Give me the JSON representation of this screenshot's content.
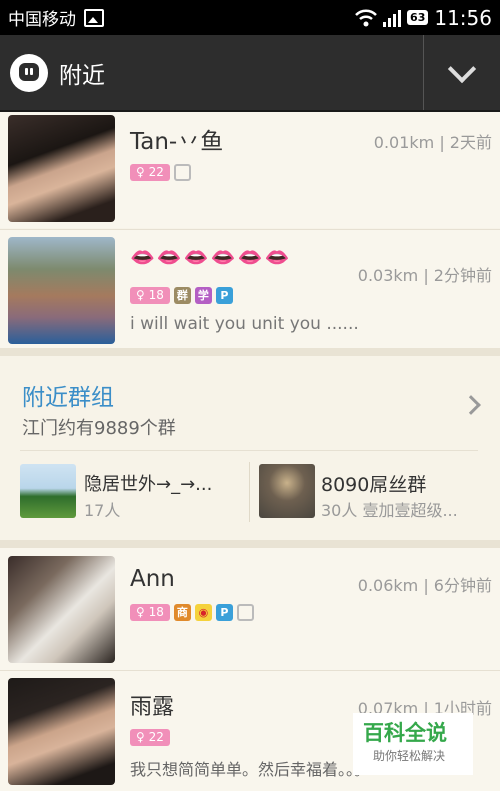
{
  "status_bar": {
    "carrier": "中国移动",
    "battery": "63",
    "time": "11:56"
  },
  "app_bar": {
    "title": "附近"
  },
  "people": [
    {
      "name": "Tan-丷鱼",
      "meta": "0.01km | 2天前",
      "age": "22"
    },
    {
      "name": "👄👄👄👄👄👄",
      "meta": "0.03km | 2分钟前",
      "age": "18",
      "tags": [
        "群",
        "学"
      ],
      "signature": "i will wait you unit you ......"
    },
    {
      "name": "Ann",
      "meta": "0.06km | 6分钟前",
      "age": "18",
      "tags": [
        "商"
      ]
    },
    {
      "name": "雨露",
      "meta": "0.07km | 1小时前",
      "age": "22",
      "signature": "我只想简简单单。然后幸福着。。。"
    }
  ],
  "groups": {
    "title": "附近群组",
    "count": "江门约有9889个群",
    "items": [
      {
        "name": "隐居世外→_→...",
        "desc": "17人"
      },
      {
        "name": "8090屌丝群",
        "desc": "30人 壹加壹超级..."
      }
    ]
  },
  "watermark": {
    "title": "百科全说",
    "subtitle": "助你轻松解决"
  },
  "colors": {
    "accent": "#3b8ec8",
    "age_badge": "#f18fb9",
    "appbar": "#2d2d2d"
  }
}
